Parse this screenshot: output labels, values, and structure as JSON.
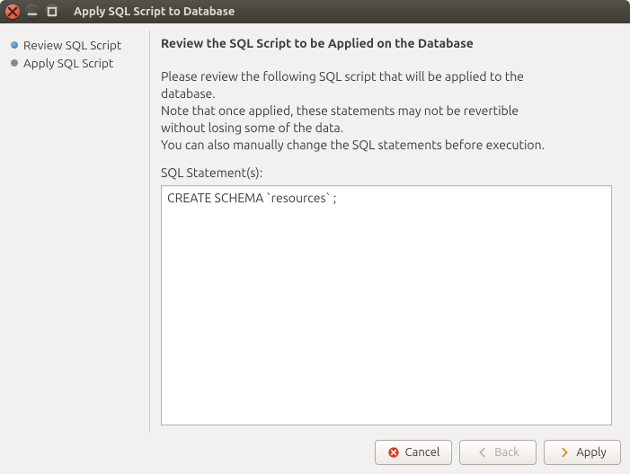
{
  "window": {
    "title": "Apply SQL Script to Database"
  },
  "sidebar": {
    "steps": [
      {
        "label": "Review SQL Script",
        "active": true
      },
      {
        "label": "Apply SQL Script",
        "active": false
      }
    ]
  },
  "main": {
    "heading": "Review the SQL Script to be Applied on the Database",
    "description": "Please review the following SQL script that will be applied to the database.\nNote that once applied, these statements may not be revertible without losing some of the data.\nYou can also manually change the SQL statements before execution.",
    "statements_label": "SQL Statement(s):",
    "sql": "CREATE SCHEMA `resources` ;\n"
  },
  "buttons": {
    "cancel": "Cancel",
    "back": "Back",
    "apply": "Apply"
  }
}
